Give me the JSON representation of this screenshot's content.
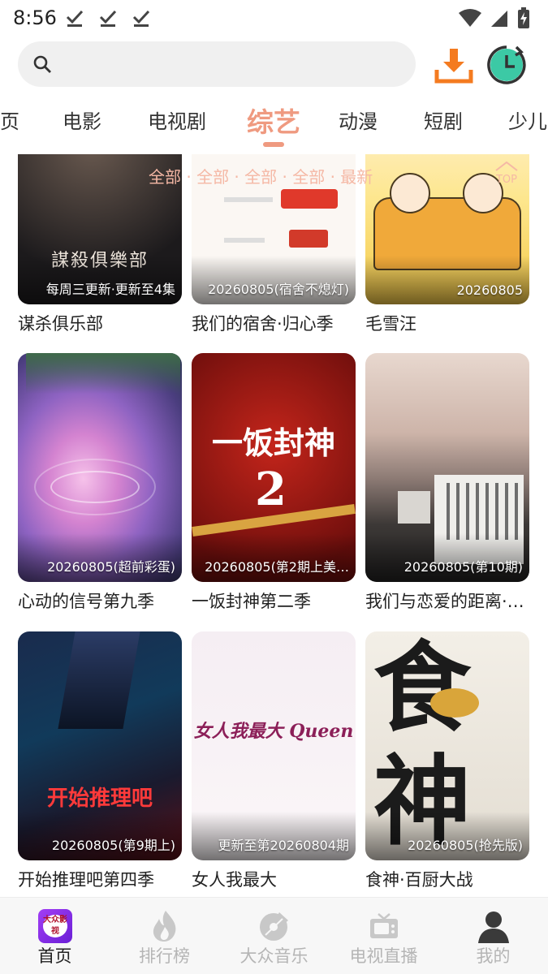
{
  "status_bar": {
    "time": "8:56"
  },
  "search": {
    "placeholder": ""
  },
  "tabs": [
    {
      "label": "页"
    },
    {
      "label": "电影"
    },
    {
      "label": "电视剧"
    },
    {
      "label": "综艺",
      "active": true
    },
    {
      "label": "动漫"
    },
    {
      "label": "短剧"
    },
    {
      "label": "少儿"
    }
  ],
  "filter": {
    "text": "全部 · 全部 · 全部 · 全部 · 最新",
    "top_label": "TOP"
  },
  "colors": {
    "accent": "#ef9a80",
    "download_orange": "#f47b20",
    "history_teal": "#3cc9a5",
    "app_logo": "#7b2ff0"
  },
  "items": [
    {
      "title": "谋杀俱乐部",
      "badge": "每周三更新·更新至4集",
      "poster_text": "謀殺俱樂部"
    },
    {
      "title": "我们的宿舍·归心季",
      "badge": "20260805(宿舍不熄灯)"
    },
    {
      "title": "毛雪汪",
      "badge": "20260805"
    },
    {
      "title": "心动的信号第九季",
      "badge": "20260805(超前彩蛋)"
    },
    {
      "title": "一饭封神第二季",
      "badge": "20260805(第2期上美…",
      "poster_text": "一饭封神"
    },
    {
      "title": "我们与恋爱的距离·…",
      "badge": "20260805(第10期)"
    },
    {
      "title": "开始推理吧第四季",
      "badge": "20260805(第9期上)",
      "poster_text": "开始推理吧"
    },
    {
      "title": "女人我最大",
      "badge": "更新至第20260804期",
      "poster_text": "女人我最大 Queen"
    },
    {
      "title": "食神·百厨大战",
      "badge": "20260805(抢先版)",
      "poster_text": "食神"
    }
  ],
  "bottom_nav": [
    {
      "label": "首页",
      "icon": "app-logo-icon",
      "logo_text": "大众影视",
      "active": true
    },
    {
      "label": "排行榜",
      "icon": "fire-icon"
    },
    {
      "label": "大众音乐",
      "icon": "music-disc-icon"
    },
    {
      "label": "电视直播",
      "icon": "tv-icon"
    },
    {
      "label": "我的",
      "icon": "user-icon"
    }
  ]
}
